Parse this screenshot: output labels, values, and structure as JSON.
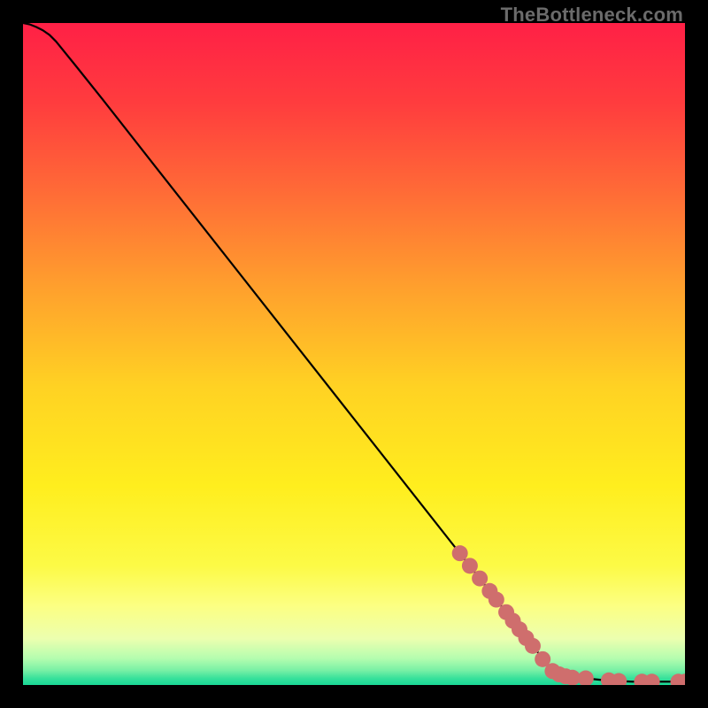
{
  "watermark": "TheBottleneck.com",
  "colors": {
    "frame": "#000000",
    "gradient_stops": [
      {
        "y": 0.0,
        "color": "rgb(255, 32, 70)"
      },
      {
        "y": 0.12,
        "color": "rgb(255, 60, 62)"
      },
      {
        "y": 0.25,
        "color": "rgb(255, 105, 55)"
      },
      {
        "y": 0.4,
        "color": "rgb(255, 160, 45)"
      },
      {
        "y": 0.55,
        "color": "rgb(255, 210, 35)"
      },
      {
        "y": 0.7,
        "color": "rgb(255, 238, 30)"
      },
      {
        "y": 0.82,
        "color": "rgb(252, 250, 70)"
      },
      {
        "y": 0.88,
        "color": "rgb(252, 255, 130)"
      },
      {
        "y": 0.93,
        "color": "rgb(236, 255, 175)"
      },
      {
        "y": 0.96,
        "color": "rgb(180, 253, 175)"
      },
      {
        "y": 0.978,
        "color": "rgb(120, 240, 165)"
      },
      {
        "y": 0.99,
        "color": "rgb(55, 225, 155)"
      },
      {
        "y": 1.0,
        "color": "rgb(25, 215, 150)"
      }
    ],
    "curve": "#000000",
    "marker_fill": "#cf6e6d",
    "marker_stroke": "#a84f4e"
  },
  "chart_data": {
    "type": "line",
    "title": "",
    "xlabel": "",
    "ylabel": "",
    "xlim": [
      0,
      100
    ],
    "ylim": [
      0,
      100
    ],
    "series": [
      {
        "name": "curve",
        "x": [
          0,
          1,
          2,
          3,
          4,
          5,
          8,
          12,
          20,
          30,
          40,
          50,
          60,
          70,
          80,
          85,
          88,
          92,
          96,
          100
        ],
        "y": [
          100.0,
          99.8,
          99.4,
          98.9,
          98.2,
          97.2,
          93.5,
          88.5,
          78.3,
          65.6,
          52.9,
          40.2,
          27.5,
          14.8,
          2.1,
          1.0,
          0.7,
          0.5,
          0.5,
          0.5
        ]
      }
    ],
    "markers": {
      "name": "highlighted-points",
      "x": [
        66.0,
        67.5,
        69.0,
        70.5,
        71.5,
        73.0,
        74.0,
        75.0,
        76.0,
        77.0,
        78.5,
        80.0,
        81.0,
        82.0,
        83.0,
        85.0,
        88.5,
        90.0,
        93.5,
        95.0,
        99.0,
        100.0
      ],
      "y": [
        19.9,
        18.0,
        16.1,
        14.2,
        12.9,
        11.0,
        9.7,
        8.4,
        7.1,
        5.9,
        3.9,
        2.1,
        1.6,
        1.3,
        1.1,
        1.0,
        0.7,
        0.6,
        0.5,
        0.5,
        0.5,
        0.5
      ]
    }
  }
}
